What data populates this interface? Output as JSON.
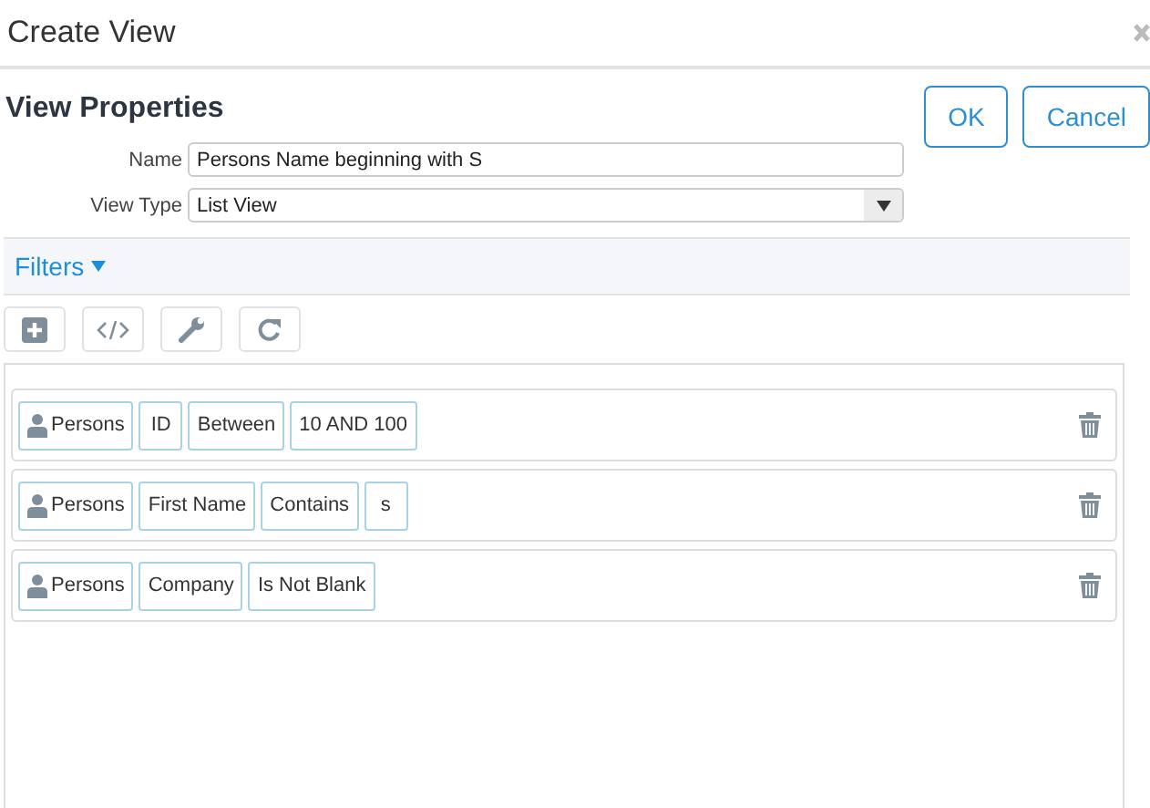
{
  "window": {
    "title": "Create View"
  },
  "heading": "View Properties",
  "buttons": [
    "OK",
    "Cancel"
  ],
  "form": [
    {
      "label": "Name",
      "kind": "text",
      "value": "Persons Name beginning with S"
    },
    {
      "label": "View Type",
      "kind": "select",
      "value": "List View"
    }
  ],
  "filters": {
    "title": "Filters",
    "expanded": true,
    "rows": [
      {
        "entity": "Persons",
        "parts": [
          "ID",
          "Between",
          "10 AND 100"
        ]
      },
      {
        "entity": "Persons",
        "parts": [
          "First Name",
          "Contains",
          "s"
        ]
      },
      {
        "entity": "Persons",
        "parts": [
          "Company",
          "Is Not Blank"
        ]
      }
    ]
  }
}
